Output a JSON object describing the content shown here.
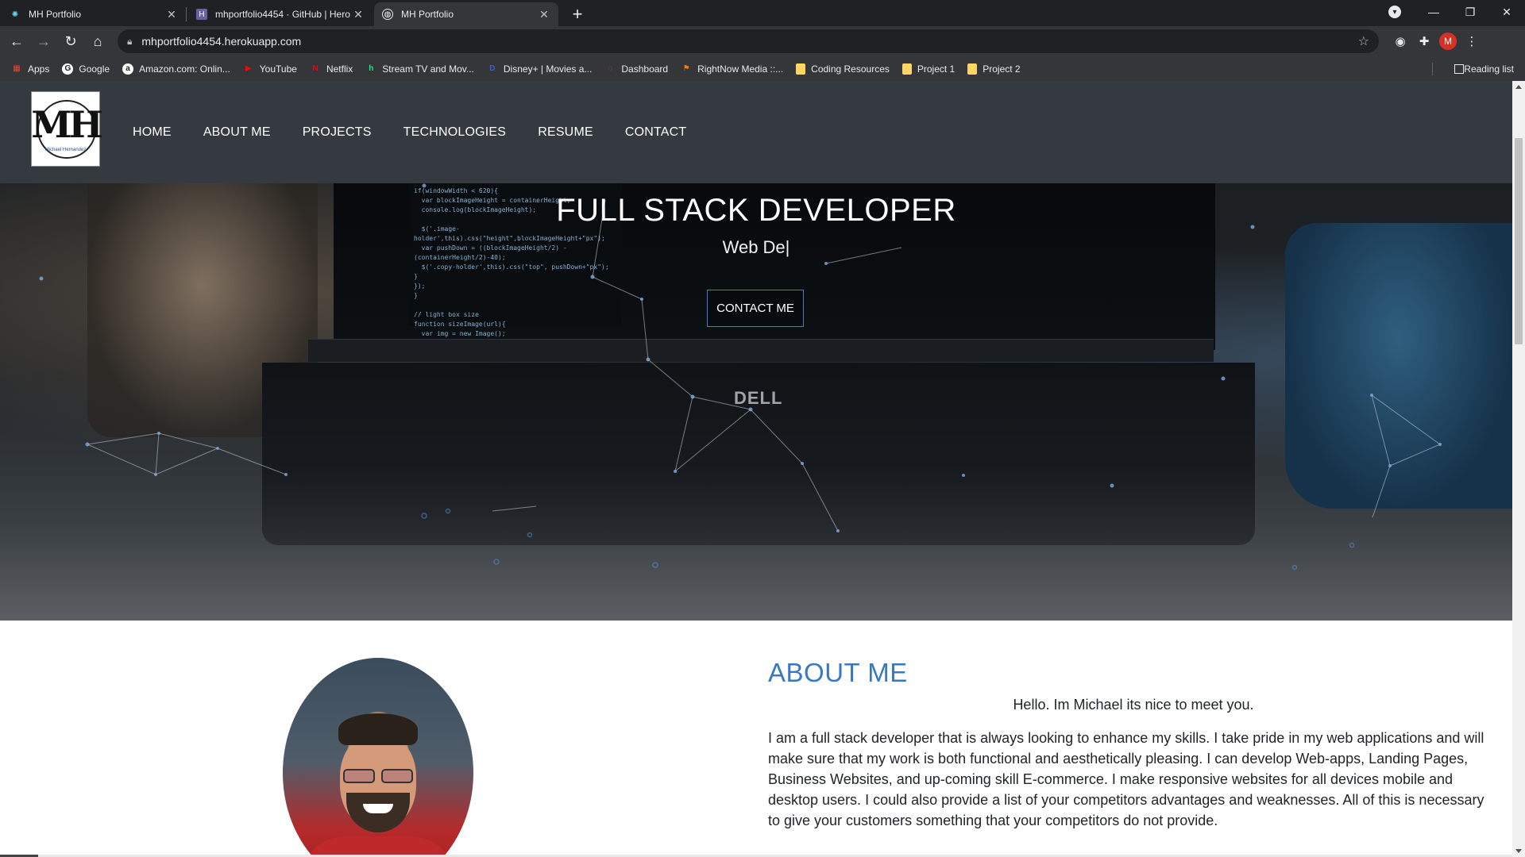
{
  "browser": {
    "tabs": [
      {
        "title": "MH Portfolio",
        "icon": "react-icon",
        "active": false
      },
      {
        "title": "mhportfolio4454 · GitHub | Hero",
        "icon": "heroku-icon",
        "active": false
      },
      {
        "title": "MH Portfolio",
        "icon": "globe-icon",
        "active": true
      }
    ],
    "url": "mhportfolio4454.herokuapp.com",
    "profile_initial": "M",
    "bookmarks": [
      {
        "label": "Apps",
        "icon": "apps-grid-icon",
        "color": "#ea4335"
      },
      {
        "label": "Google",
        "icon": "google-icon",
        "color": "#ffffff"
      },
      {
        "label": "Amazon.com: Onlin...",
        "icon": "amazon-icon",
        "color": "#ffffff"
      },
      {
        "label": "YouTube",
        "icon": "youtube-icon",
        "color": "#ff0000"
      },
      {
        "label": "Netflix",
        "icon": "netflix-icon",
        "color": "#e50914"
      },
      {
        "label": "Stream TV and Mov...",
        "icon": "hulu-icon",
        "color": "#1ce783"
      },
      {
        "label": "Disney+ | Movies a...",
        "icon": "disney-icon",
        "color": "#3f5dd8"
      },
      {
        "label": "Dashboard",
        "icon": "dashboard-icon",
        "color": "#e53935"
      },
      {
        "label": "RightNow Media ::...",
        "icon": "rightnow-icon",
        "color": "#f57c00"
      },
      {
        "label": "Coding Resources",
        "icon": "folder-icon",
        "color": "#fdd663"
      },
      {
        "label": "Project 1",
        "icon": "folder-icon",
        "color": "#fdd663"
      },
      {
        "label": "Project 2",
        "icon": "folder-icon",
        "color": "#fdd663"
      }
    ],
    "reading_list": "Reading list"
  },
  "site": {
    "logo_text": "MH",
    "logo_caption": "Michael Hernandez",
    "nav": [
      "HOME",
      "ABOUT ME",
      "PROJECTS",
      "TECHNOLOGIES",
      "RESUME",
      "CONTACT"
    ],
    "hero": {
      "title": "FULL STACK DEVELOPER",
      "subtitle": "Web De|",
      "cta": "CONTACT ME",
      "laptop_brand": "DELL"
    },
    "about": {
      "heading": "ABOUT ME",
      "greeting": "Hello. Im Michael its nice to meet you.",
      "body": "I am a full stack developer that is always looking to enhance my skills. I take pride in my web applications and will make sure that my work is both functional and aesthetically pleasing. I can develop Web-apps, Landing Pages, Business Websites, and up-coming skill E-commerce. I make responsive websites for all devices mobile and desktop users. I could also provide a list of your competitors advantages and weaknesses. All of this is necessary to give your customers something that your competitors do not provide."
    },
    "colors": {
      "nav_bg": "#343a40",
      "accent": "#3a78c3",
      "button_border": "#3a7bd5"
    }
  }
}
